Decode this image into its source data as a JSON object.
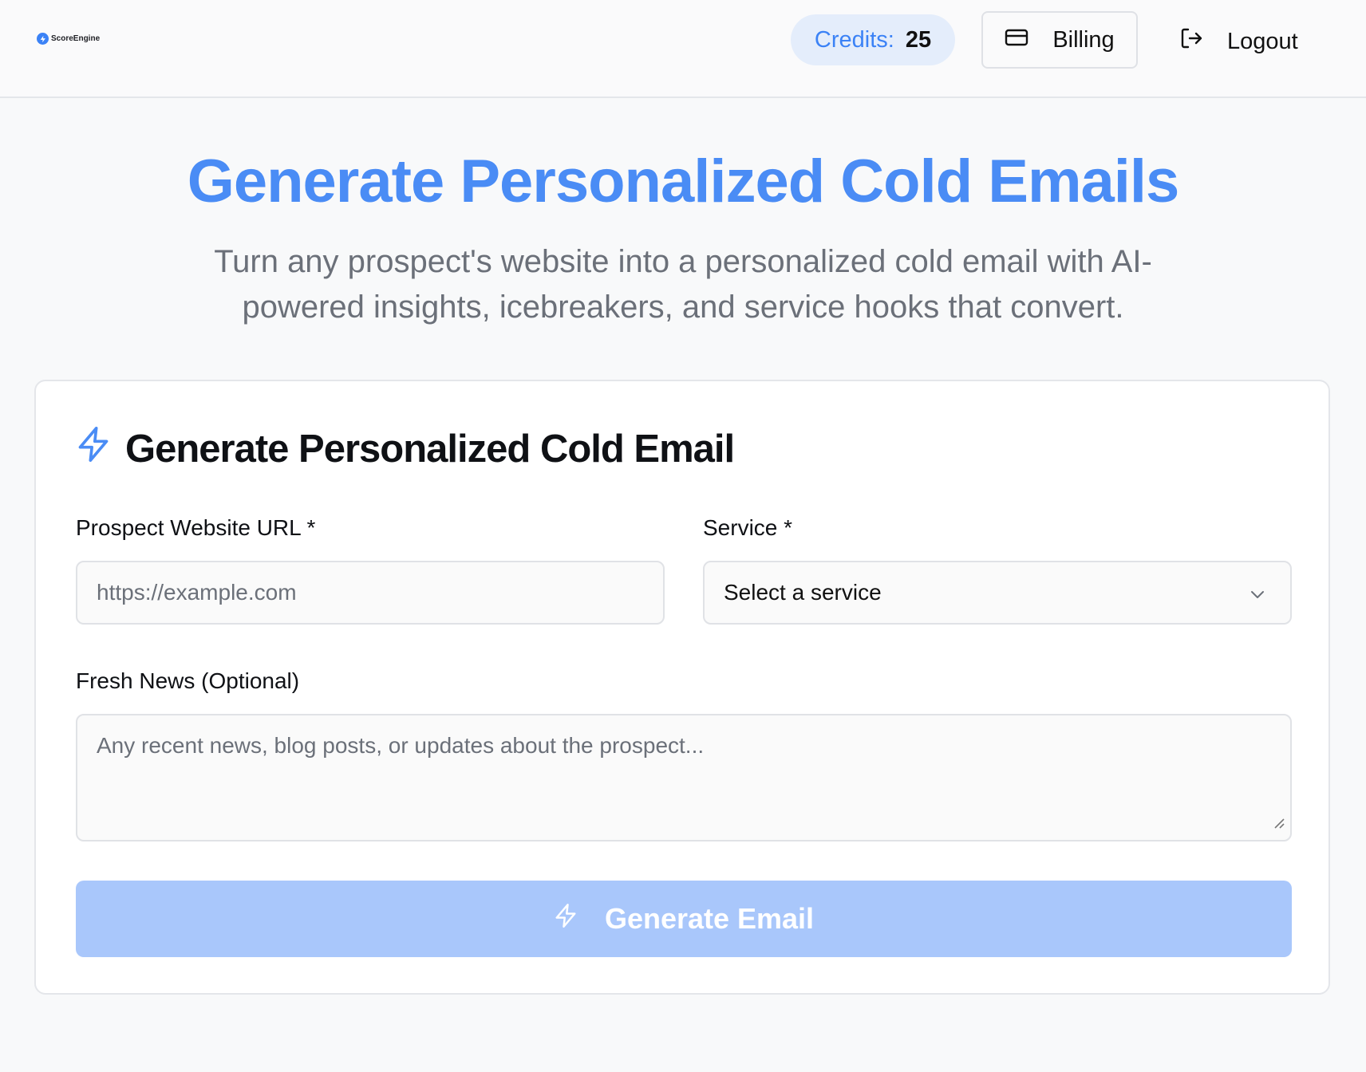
{
  "header": {
    "logo_text": "ScoreEngine",
    "credits_label": "Credits:",
    "credits_value": "25",
    "billing_label": "Billing",
    "logout_label": "Logout"
  },
  "hero": {
    "title": "Generate Personalized Cold Emails",
    "subtitle": "Turn any prospect's website into a personalized cold email with AI-powered insights, icebreakers, and service hooks that convert."
  },
  "form": {
    "title": "Generate Personalized Cold Email",
    "url_label": "Prospect Website URL *",
    "url_placeholder": "https://example.com",
    "service_label": "Service *",
    "service_selected": "Select a service",
    "news_label": "Fresh News (Optional)",
    "news_placeholder": "Any recent news, blog posts, or updates about the prospect...",
    "submit_label": "Generate Email"
  },
  "colors": {
    "accent": "#4a8cf5",
    "button_disabled": "#a9c7fb",
    "credits_bg": "#e4edfb"
  },
  "icons": {
    "logo": "lightning-badge-icon",
    "billing": "credit-card-icon",
    "logout": "logout-icon",
    "form_title": "lightning-icon",
    "select": "chevron-down-icon",
    "submit": "lightning-icon"
  }
}
